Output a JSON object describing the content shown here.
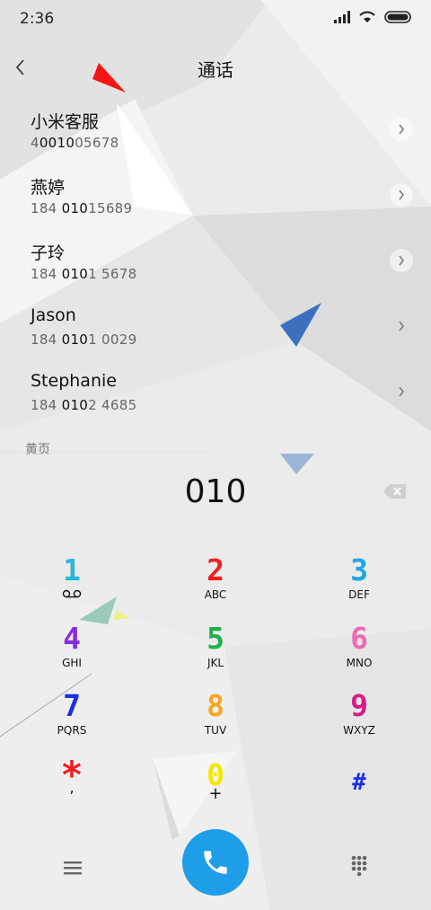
{
  "status_bar": {
    "time": "2:36"
  },
  "header": {
    "title": "通话"
  },
  "contacts": [
    {
      "name": "小米客服",
      "num_pre": "4",
      "num_match": "0010",
      "num_post": "05678"
    },
    {
      "name": "燕婷",
      "num_pre": "184 ",
      "num_match": "010",
      "num_post": "15689"
    },
    {
      "name": "子玲",
      "num_pre": "184 ",
      "num_match": "010",
      "num_post": "1 5678"
    },
    {
      "name": "Jason",
      "num_pre": "184 ",
      "num_match": "010",
      "num_post": "1 0029"
    },
    {
      "name": "Stephanie",
      "num_pre": "184 ",
      "num_match": "010",
      "num_post": "2 4685"
    }
  ],
  "section_label": "黄页",
  "dialer": {
    "entered": "010",
    "keys": [
      {
        "digit": "1",
        "letters": "",
        "color": "#2bb7d6"
      },
      {
        "digit": "2",
        "letters": "ABC",
        "color": "#f01f1f"
      },
      {
        "digit": "3",
        "letters": "DEF",
        "color": "#1ea7e8"
      },
      {
        "digit": "4",
        "letters": "GHI",
        "color": "#8a2be2"
      },
      {
        "digit": "5",
        "letters": "JKL",
        "color": "#1fb24a"
      },
      {
        "digit": "6",
        "letters": "MNO",
        "color": "#f06ab0"
      },
      {
        "digit": "7",
        "letters": "PQRS",
        "color": "#1d2fe0"
      },
      {
        "digit": "8",
        "letters": "TUV",
        "color": "#f5a623"
      },
      {
        "digit": "9",
        "letters": "WXYZ",
        "color": "#d81b8c"
      },
      {
        "digit": "*",
        "letters": ",",
        "color": "#f01f1f"
      },
      {
        "digit": "0",
        "letters": "+",
        "color": "#f3e600"
      },
      {
        "digit": "#",
        "letters": "",
        "color": "#1d2fe0"
      }
    ]
  },
  "icons": {
    "back": "chevron-left-icon",
    "call": "phone-icon",
    "menu": "menu-icon",
    "keypad": "keypad-icon",
    "delete": "backspace-icon"
  },
  "colors": {
    "call_button": "#1e9de8"
  }
}
